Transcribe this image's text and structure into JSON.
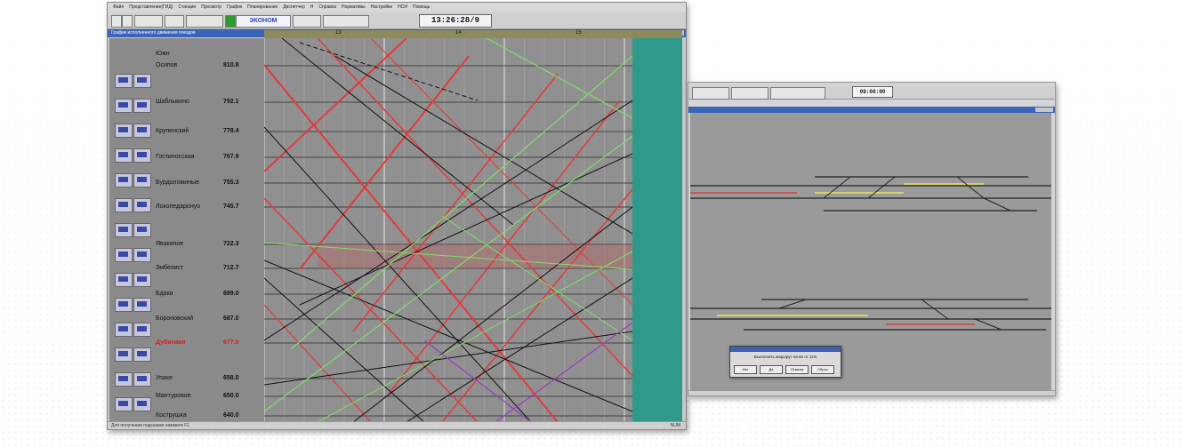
{
  "main_window": {
    "menu": [
      "Файл",
      "Представление(ГИД)",
      "Станции",
      "Просмотр",
      "График",
      "Планирование",
      "Диспетчер",
      "Н",
      "Справка",
      "Нормативы",
      "Настройки",
      "НСИ",
      "Помощь"
    ],
    "clock": "13:26:28/9",
    "toolbar_tag": "ЭКОНОМ",
    "title": "График исполненного движения поездов",
    "hours": [
      "13",
      "14",
      "15"
    ],
    "header_label": "Южн",
    "stations": [
      {
        "name": "Осипов",
        "km": "810.8",
        "red": false
      },
      {
        "name": "Шаблыкино",
        "km": "792.1",
        "red": false
      },
      {
        "name": "Крупенский",
        "km": "778.4",
        "red": false
      },
      {
        "name": "Гостиносская",
        "km": "767.9",
        "red": false
      },
      {
        "name": "Бурдоломиные",
        "km": "755.3",
        "red": false
      },
      {
        "name": "Локопедаронуо",
        "km": "745.7",
        "red": false
      },
      {
        "name": "Явакиное",
        "km": "722.3",
        "red": false
      },
      {
        "name": "Змбелист",
        "km": "712.7",
        "red": false
      },
      {
        "name": "Бдаки",
        "km": "699.0",
        "red": false
      },
      {
        "name": "Бороновский",
        "km": "687.0",
        "red": false
      },
      {
        "name": "Дубинаки",
        "km": "677.0",
        "red": true
      },
      {
        "name": "Упаке",
        "km": "658.0",
        "red": false
      },
      {
        "name": "Мантуровое",
        "km": "650.0",
        "red": false
      },
      {
        "name": "Кострушка",
        "km": "640.0",
        "red": false
      }
    ],
    "status_left": "Для получения подсказки нажмите F1",
    "status_right": "NUM"
  },
  "second_window": {
    "clock": "09:00:00",
    "dialog": {
      "message": "Выполнить маршрут на 8п от 2Нп",
      "buttons": [
        "Нет",
        "Да",
        "Отмена",
        "Сброс"
      ]
    }
  },
  "colors": {
    "grid_bg": "#909090",
    "train_red": "#e33a3a",
    "train_green": "#7fdd6a",
    "train_black": "#111111",
    "train_purple": "#9b3bc0",
    "teal": "#2f9a8c"
  }
}
